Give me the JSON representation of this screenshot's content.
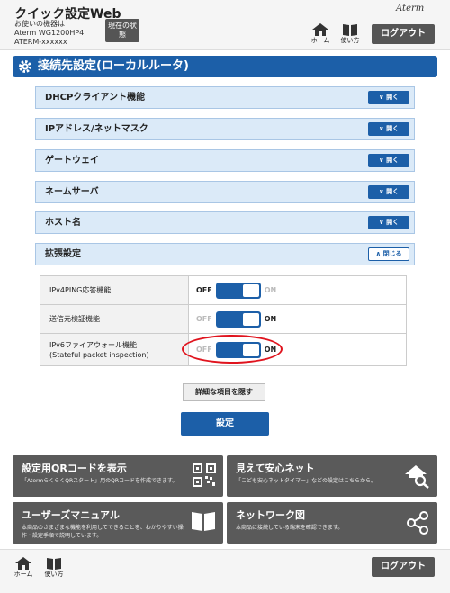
{
  "header": {
    "app_title": "クイック設定Web",
    "device_caption": "お使いの機器は",
    "device_model": "Aterm WG1200HP4",
    "device_id": "ATERM-xxxxxx",
    "status_button": "現在の状態",
    "home_label": "ホーム",
    "help_label": "使い方",
    "brand": "Aterm",
    "logout_label": "ログアウト"
  },
  "section": {
    "title": "接続先設定(ローカルルータ)"
  },
  "accordion": [
    {
      "label": "DHCPクライアント機能",
      "button": "開く"
    },
    {
      "label": "IPアドレス/ネットマスク",
      "button": "開く"
    },
    {
      "label": "ゲートウェイ",
      "button": "開く"
    },
    {
      "label": "ネームサーバ",
      "button": "開く"
    },
    {
      "label": "ホスト名",
      "button": "開く"
    },
    {
      "label": "拡張設定",
      "button": "閉じる"
    }
  ],
  "settings": [
    {
      "label": "IPv4PING応答機能",
      "off": "OFF",
      "on": "ON",
      "state": "on"
    },
    {
      "label": "送信元検証機能",
      "off": "OFF",
      "on": "ON",
      "state": "on"
    },
    {
      "label_line1": "IPv6ファイアウォール機能",
      "label_line2": "(Stateful packet inspection)",
      "off": "OFF",
      "on": "ON",
      "state": "on"
    }
  ],
  "buttons": {
    "details": "詳細な項目を隠す",
    "submit": "設定"
  },
  "panels": [
    {
      "title": "設定用QRコードを表示",
      "desc": "「AtermらくらくQRスタート」用のQRコードを作成できます。",
      "icon": "qr-code-icon"
    },
    {
      "title": "見えて安心ネット",
      "desc": "「こども安心ネットタイマー」などの設定はこちらから。",
      "icon": "home-search-icon"
    },
    {
      "title": "ユーザーズマニュアル",
      "desc": "本商品のさまざまな機能を利用してできることを、わかりやすい操作・設定手順で説明しています。",
      "icon": "book-icon"
    },
    {
      "title": "ネットワーク図",
      "desc": "本商品に接続している端末を確認できます。",
      "icon": "share-nodes-icon"
    }
  ],
  "footer": {
    "home_label": "ホーム",
    "help_label": "使い方",
    "logout_label": "ログアウト"
  },
  "colors": {
    "primary": "#1c5fa8",
    "panel": "#5a5a5a",
    "highlight": "#e0141e"
  }
}
